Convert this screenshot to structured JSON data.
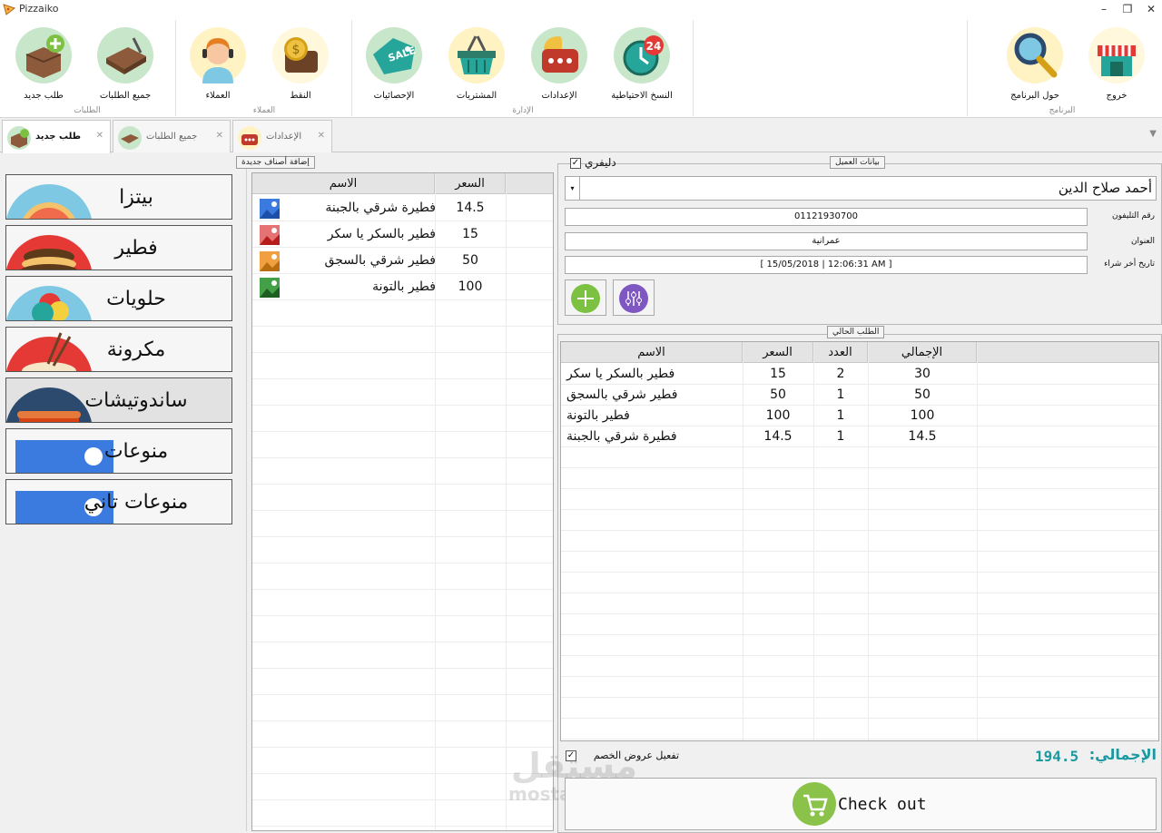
{
  "window": {
    "title": "Pizzaiko",
    "minimize": "–",
    "restore": "❐",
    "close": "✕"
  },
  "ribbon": {
    "buttons": [
      {
        "id": "new-order",
        "label": "طلب جديد",
        "color": "#c8e6c9"
      },
      {
        "id": "all-orders",
        "label": "جميع الطلبات",
        "color": "#c8e6c9"
      },
      {
        "id": "customers",
        "label": "العملاء",
        "color": "#fff3c4"
      },
      {
        "id": "cash",
        "label": "النقط",
        "color": "#fff8dc"
      },
      {
        "id": "statistics",
        "label": "الإحصائيات",
        "color": "#c8e6c9"
      },
      {
        "id": "purchases",
        "label": "المشتريات",
        "color": "#fff3c4"
      },
      {
        "id": "settings",
        "label": "الإعدادات",
        "color": "#c8e6c9"
      },
      {
        "id": "backup",
        "label": "النسخ الاحتياطية",
        "color": "#c8e6c9"
      },
      {
        "id": "about",
        "label": "حول البرنامج",
        "color": "#fff3c4"
      },
      {
        "id": "exit",
        "label": "خروج",
        "color": "#fff8dc"
      }
    ],
    "groups": [
      "الطلبات",
      "العملاء",
      "الإدارة",
      "البرنامج"
    ]
  },
  "tabs": [
    {
      "label": "طلب جديد",
      "close": "✕"
    },
    {
      "label": "جميع الطلبات",
      "close": "✕"
    },
    {
      "label": "الإعدادات",
      "close": "✕"
    }
  ],
  "tab_menu": "▼",
  "categories": [
    {
      "label": "بيتزا",
      "color": "#7ec8e3",
      "accent": "#f06b4b"
    },
    {
      "label": "فطير",
      "color": "#e53935",
      "accent": "#5d3a1a"
    },
    {
      "label": "حلويات",
      "color": "#7ec8e3",
      "accent": "#e53935"
    },
    {
      "label": "مكرونة",
      "color": "#e53935",
      "accent": "#f5e6c8"
    },
    {
      "label": "ساندوتيشات",
      "color": "#2c4a6e",
      "accent": "#e57a3c"
    },
    {
      "label": "منوعات",
      "color": "#3b7be0",
      "accent": "#ffffff"
    },
    {
      "label": "منوعات تاني",
      "color": "#3b7be0",
      "accent": "#ffffff"
    }
  ],
  "products": {
    "caption": "إضافة أصناف جديدة",
    "headers": {
      "name": "الاسم",
      "price": "السعر"
    },
    "rows": [
      {
        "name": "فطيرة شرقي بالجبنة",
        "price": "14.5",
        "img": "#3b7be0"
      },
      {
        "name": "فطير  بالسكر يا سكر",
        "price": "15",
        "img": "#e57373"
      },
      {
        "name": "فطير شرقي بالسجق",
        "price": "50",
        "img": "#f0a040"
      },
      {
        "name": "فطير بالتونة",
        "price": "100",
        "img": "#43a047"
      }
    ]
  },
  "customer": {
    "caption": "بيانات العميل",
    "delivery_label": "دليفري",
    "delivery_check": "✓",
    "name": "أحمد صلاح الدين",
    "dropdown": "▾",
    "phone_label": "رقم التليفون",
    "phone": "01121930700",
    "address_label": "العنوان",
    "address": "عمرانية",
    "last_purchase_label": "تاريخ أخر شراء",
    "last_purchase": "[ 15/05/2018 | 12:06:31 AM ]",
    "add_color": "#7cc142",
    "edit_color": "#7e57c2"
  },
  "order": {
    "caption": "الطلب الحالي",
    "headers": {
      "name": "الاسم",
      "price": "السعر",
      "qty": "العدد",
      "total": "الإجمالي"
    },
    "rows": [
      {
        "name": "فطير  بالسكر يا سكر",
        "price": "15",
        "qty": "2",
        "total": "30"
      },
      {
        "name": "فطير شرقي بالسجق",
        "price": "50",
        "qty": "1",
        "total": "50"
      },
      {
        "name": "فطير بالتونة",
        "price": "100",
        "qty": "1",
        "total": "100"
      },
      {
        "name": "فطيرة شرقي بالجبنة",
        "price": "14.5",
        "qty": "1",
        "total": "14.5"
      }
    ],
    "total_label": "الإجمالي:",
    "total": "194.5",
    "discount_label": "تفعيل عروض الخصم",
    "discount_check": "✓",
    "checkout_label": "Check out",
    "accent": "#1a9aa0"
  },
  "watermark": {
    "line1": "مستقل",
    "line2": "mostaql.com"
  }
}
